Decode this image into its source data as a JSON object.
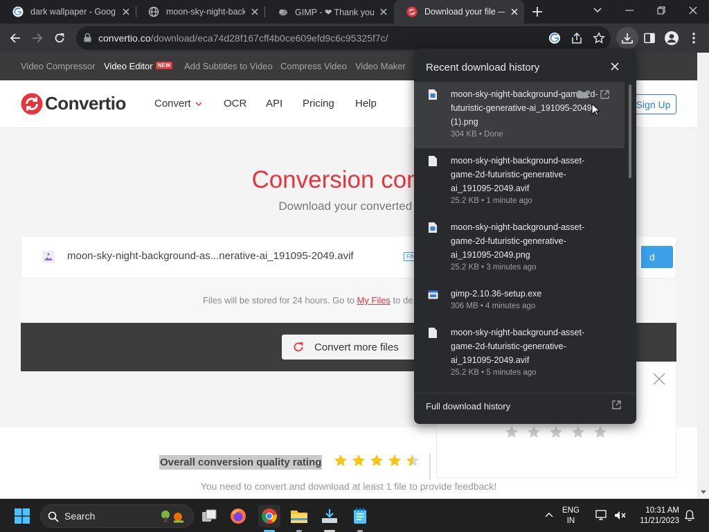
{
  "browser": {
    "tabs": [
      {
        "title": "dark wallpaper - Goog",
        "favicon": "google-icon"
      },
      {
        "title": "moon-sky-night-backg",
        "favicon": "globe-icon"
      },
      {
        "title": "GIMP - ❤ Thank you",
        "favicon": "gimp-icon"
      },
      {
        "title": "Download your file —",
        "favicon": "convertio-icon",
        "active": true
      }
    ],
    "url_host": "convertio.co",
    "url_path": "/download/eca74d28f167cff4b0ce609efd9c6c95325f7c/"
  },
  "site": {
    "topnav": [
      {
        "label": "Video Compressor"
      },
      {
        "label": "Video Editor",
        "badge": "NEW"
      },
      {
        "label": "Add Subtitles to Video"
      },
      {
        "label": "Compress Video"
      },
      {
        "label": "Video Maker"
      }
    ],
    "brand": "Convertio",
    "nav": {
      "convert": "Convert",
      "ocr": "OCR",
      "api": "API",
      "pricing": "Pricing",
      "help": "Help"
    },
    "signup": "Sign Up",
    "heading": "Conversion compl",
    "subheading": "Download your converted f",
    "file": {
      "name": "moon-sky-night-background-as...nerative-ai_191095-2049.avif",
      "badge": "FIN",
      "download_label": "d"
    },
    "storage": {
      "before": "Files will be stored for 24 hours. Go to ",
      "link": "My Files",
      "after": " to de"
    },
    "convert_more": "Convert more files",
    "rating": {
      "title": "Overall conversion quality rating",
      "stars": 4.5,
      "note": "You need to convert and download at least 1 file to provide feedback!"
    },
    "feedback_stars": 5
  },
  "downloads": {
    "title": "Recent download history",
    "items": [
      {
        "name": "moon-sky-night-background-game-2d-futuristic-generative-ai_191095-2049 (1).png",
        "meta": "304 KB • Done",
        "icon": "image-file-icon"
      },
      {
        "name": "moon-sky-night-background-asset-game-2d-futuristic-generative-ai_191095-2049.avif",
        "meta": "25.2 KB • 1 minute ago",
        "icon": "file-icon"
      },
      {
        "name": "moon-sky-night-background-asset-game-2d-futuristic-generative-ai_191095-2049.png",
        "meta": "25.2 KB • 3 minutes ago",
        "icon": "image-file-icon"
      },
      {
        "name": "gimp-2.10.36-setup.exe",
        "meta": "306 MB • 4 minutes ago",
        "icon": "exe-file-icon"
      },
      {
        "name": "moon-sky-night-background-asset-game-2d-futuristic-generative-ai_191095-2049.avif",
        "meta": "25.2 KB • 5 minutes ago",
        "icon": "file-icon"
      }
    ],
    "full_history": "Full download history"
  },
  "taskbar": {
    "search": "Search",
    "lang_top": "ENG",
    "lang_bottom": "IN",
    "time": "10:31 AM",
    "date": "11/21/2023"
  }
}
